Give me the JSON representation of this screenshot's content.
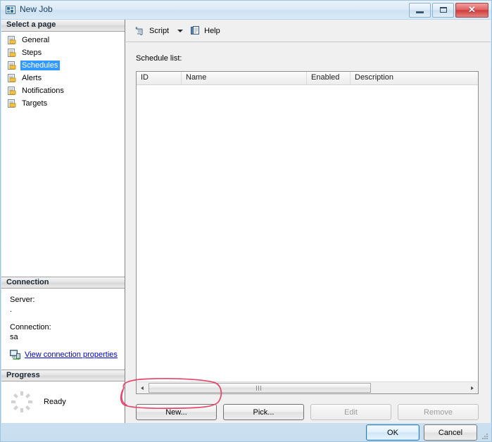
{
  "window": {
    "title": "New Job",
    "icon": "ssms-dialog-icon",
    "controls": {
      "minimize": "Minimize",
      "maximize": "Maximize",
      "close": "Close",
      "close_glyph": "✕"
    }
  },
  "sidebar": {
    "select_page_header": "Select a page",
    "pages": [
      {
        "label": "General",
        "selected": false
      },
      {
        "label": "Steps",
        "selected": false
      },
      {
        "label": "Schedules",
        "selected": true
      },
      {
        "label": "Alerts",
        "selected": false
      },
      {
        "label": "Notifications",
        "selected": false
      },
      {
        "label": "Targets",
        "selected": false
      }
    ],
    "connection": {
      "header": "Connection",
      "server_label": "Server:",
      "server_value": ".",
      "connection_label": "Connection:",
      "connection_value": "sa",
      "link_text": "View connection properties",
      "link_icon": "server-connection-icon"
    },
    "progress": {
      "header": "Progress",
      "status": "Ready",
      "spinner_icon": "progress-spinner-icon"
    }
  },
  "toolbar": {
    "script_label": "Script",
    "script_icon": "script-scroll-icon",
    "dropdown_icon": "chevron-down-icon",
    "help_label": "Help",
    "help_icon": "help-document-icon"
  },
  "main": {
    "list_label": "Schedule list:",
    "columns": [
      "ID",
      "Name",
      "Enabled",
      "Description"
    ],
    "rows": [],
    "scrollbar": {
      "left_arrow": "◄",
      "right_arrow": "►"
    },
    "actions": [
      {
        "label": "New...",
        "enabled": true
      },
      {
        "label": "Pick...",
        "enabled": true
      },
      {
        "label": "Edit",
        "enabled": false
      },
      {
        "label": "Remove",
        "enabled": false
      }
    ]
  },
  "footer": {
    "ok_label": "OK",
    "cancel_label": "Cancel"
  },
  "annotation": {
    "shape": "hand-drawn-ellipse",
    "target": "New... button",
    "color": "#e8456a"
  }
}
